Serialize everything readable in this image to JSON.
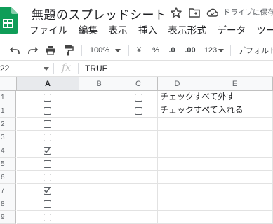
{
  "document": {
    "title": "無題のスプレッドシート",
    "drive_status": "ドライブに保存"
  },
  "menu": [
    "ファイル",
    "編集",
    "表示",
    "挿入",
    "表示形式",
    "データ",
    "ツール"
  ],
  "toolbar": {
    "zoom": "100%",
    "currency": "¥",
    "percent": "%",
    "decrease_decimal": ".0",
    "increase_decimal": ".00",
    "more_formats": "123",
    "font": "デフォルト"
  },
  "formula_bar": {
    "name_box": "22",
    "fx": "fx",
    "value": "TRUE"
  },
  "columns": [
    "A",
    "B",
    "C",
    "D",
    "E"
  ],
  "rows": [
    "1",
    "1",
    "2",
    "3",
    "4",
    "5",
    "6",
    "7",
    "8",
    "9"
  ],
  "cells": {
    "a_checkboxes": [
      false,
      false,
      false,
      false,
      true,
      false,
      false,
      true,
      false,
      false
    ],
    "c_checkboxes": [
      false,
      false
    ],
    "d_labels": [
      "チェックすべて外す",
      "チェックすべて入れる"
    ]
  },
  "colors": {
    "sheets_green": "#0f9d58",
    "grid_line": "#e2e2e2",
    "header_bg": "#f8f9fa",
    "selected_header_bg": "#e8eaed"
  }
}
